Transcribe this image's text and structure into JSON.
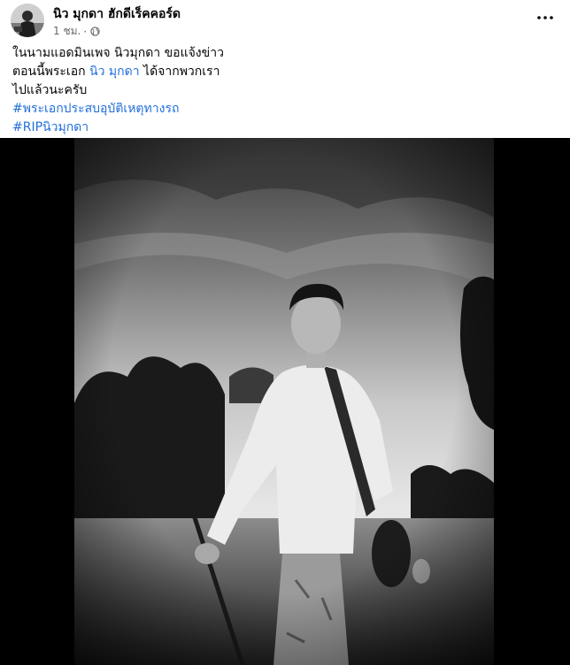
{
  "post": {
    "author": "นิว มุกดา ฮักดีเร็คคอร์ด",
    "time": "1 ชม.",
    "separator": "·",
    "privacy_icon": "globe-icon",
    "more_icon": "more-options-icon",
    "text": {
      "line1": "ในนามแอดมินเพจ นิวมุกดา ขอแจ้งข่าว",
      "line2_pre": "ตอนนี้พระเอก ",
      "line2_link": "นิว มุกดา",
      "line2_post": " ได้จากพวกเรา",
      "line3": "ไปแล้วนะครับ",
      "hashtag1": "#พระเอกประสบอุบัติเหตุทางรถ",
      "hashtag2": "#RIPนิวมุกดา"
    }
  },
  "colors": {
    "link": "#216fdb",
    "meta_gray": "#65676b",
    "photo_frame": "#000000"
  }
}
